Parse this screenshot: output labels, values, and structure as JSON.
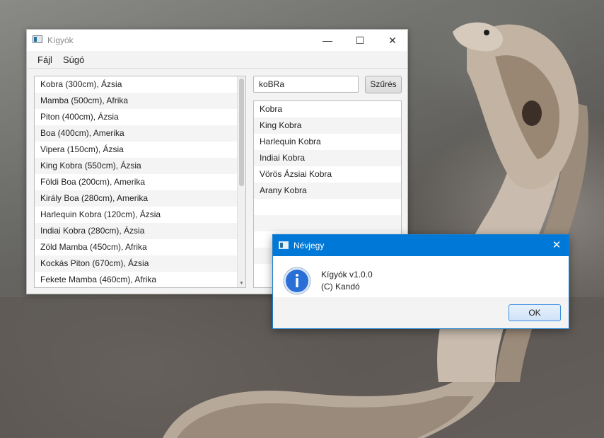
{
  "main_window": {
    "title": "Kígyók",
    "menu": [
      "Fájl",
      "Súgó"
    ],
    "snake_list": [
      "Kobra (300cm), Ázsia",
      "Mamba (500cm), Afrika",
      "Piton (400cm), Ázsia",
      "Boa (400cm), Amerika",
      "Vipera (150cm), Ázsia",
      "King Kobra (550cm), Ázsia",
      "Földi Boa (200cm), Amerika",
      "Király Boa (280cm), Amerika",
      "Harlequin Kobra (120cm), Ázsia",
      "Indiai Kobra (280cm), Ázsia",
      "Zöld Mamba (450cm), Afrika",
      "Kockás Piton (670cm), Ázsia",
      "Fekete Mamba (460cm), Afrika"
    ],
    "search_value": "koBRa",
    "filter_button": "Szűrés",
    "filtered_list": [
      "Kobra",
      "King Kobra",
      "Harlequin Kobra",
      "Indiai Kobra",
      "Vörös Ázsiai Kobra",
      "Arany Kobra"
    ]
  },
  "dialog": {
    "title": "Névjegy",
    "line1": "Kígyók v1.0.0",
    "line2": "(C) Kandó",
    "ok_button": "OK"
  },
  "colors": {
    "dialog_titlebar": "#0078d7",
    "info_icon": "#2a6fd6"
  }
}
